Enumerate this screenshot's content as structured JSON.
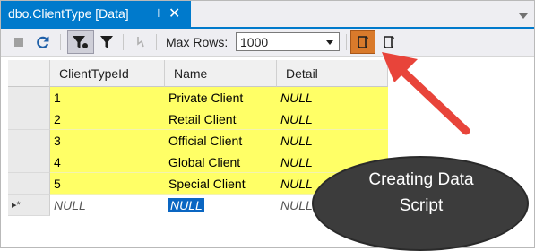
{
  "tab": {
    "title": "dbo.ClientType [Data]",
    "pin_glyph": "⊣",
    "close_glyph": "✕"
  },
  "toolbar": {
    "icons": [
      "stop-icon",
      "refresh-icon",
      "filter-active-icon",
      "filter-icon",
      "pane-icon",
      "script-data-icon",
      "script-data-icon"
    ],
    "max_rows_label": "Max Rows:",
    "max_rows_value": "1000"
  },
  "grid": {
    "columns": [
      "ClientTypeId",
      "Name",
      "Detail"
    ],
    "rows": [
      {
        "id": "1",
        "name": "Private Client",
        "detail": "NULL"
      },
      {
        "id": "2",
        "name": "Retail Client",
        "detail": "NULL"
      },
      {
        "id": "3",
        "name": "Official Client",
        "detail": "NULL"
      },
      {
        "id": "4",
        "name": "Global Client",
        "detail": "NULL"
      },
      {
        "id": "5",
        "name": "Special Client",
        "detail": "NULL"
      }
    ],
    "new_row": {
      "marker": "▸*",
      "id": "NULL",
      "name": "NULL",
      "detail": "NULL"
    },
    "highlight_color": "#ffff66",
    "selection_color": "#0a66c2"
  },
  "annotation": {
    "line1": "Creating Data",
    "line2": "Script",
    "arrow_color": "#e8443a",
    "bubble_color": "#3c3c3c"
  }
}
